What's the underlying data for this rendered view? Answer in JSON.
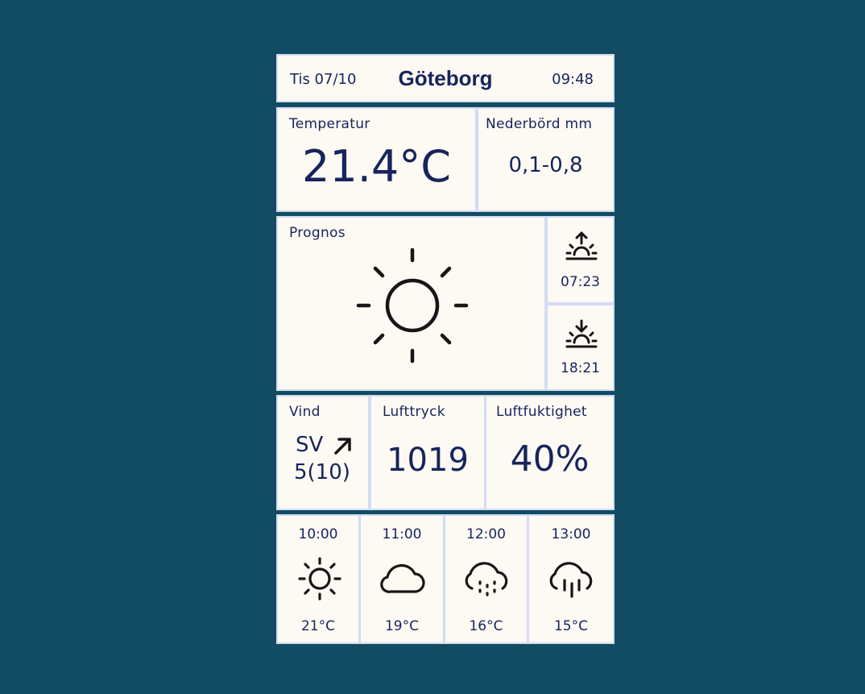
{
  "header": {
    "date": "Tis 07/10",
    "city": "Göteborg",
    "time": "09:48"
  },
  "temperature": {
    "label": "Temperatur",
    "value": "21.4°C"
  },
  "precipitation": {
    "label": "Nederbörd mm",
    "value": "0,1-0,8"
  },
  "forecast": {
    "label": "Prognos",
    "icon": "sun-icon"
  },
  "sunrise": {
    "icon": "sunrise-icon",
    "time": "07:23"
  },
  "sunset": {
    "icon": "sunset-icon",
    "time": "18:21"
  },
  "wind": {
    "label": "Vind",
    "direction": "SV",
    "direction_icon": "arrow-up-right-icon",
    "speed": "5(10)"
  },
  "pressure": {
    "label": "Lufttryck",
    "value": "1019"
  },
  "humidity": {
    "label": "Luftfuktighet",
    "value": "40%"
  },
  "hourly": [
    {
      "time": "10:00",
      "icon": "sun-icon",
      "temp": "21°C"
    },
    {
      "time": "11:00",
      "icon": "cloud-icon",
      "temp": "19°C"
    },
    {
      "time": "12:00",
      "icon": "cloud-drizzle-icon",
      "temp": "16°C"
    },
    {
      "time": "13:00",
      "icon": "cloud-rain-icon",
      "temp": "15°C"
    }
  ],
  "colors": {
    "background": "#124c63",
    "panel": "#fdf9f3",
    "panel_border": "#d3dcf2",
    "text": "#17245c",
    "icon": "#161616"
  }
}
